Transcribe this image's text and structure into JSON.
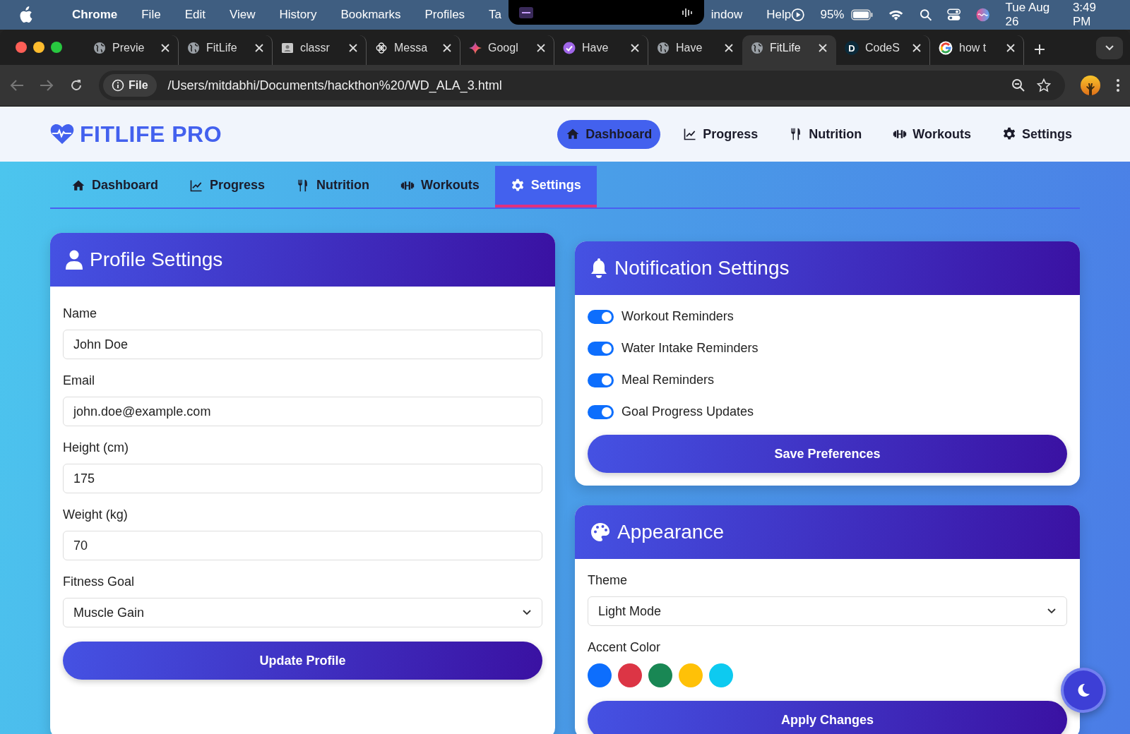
{
  "menu_bar": {
    "app": "Chrome",
    "items": [
      "File",
      "Edit",
      "View",
      "History",
      "Bookmarks",
      "Profiles",
      "Ta"
    ],
    "items_after_notch": [
      "indow",
      "Help"
    ],
    "battery": "95%",
    "date": "Tue Aug 26",
    "time": "3:49 PM"
  },
  "browser_tabs": [
    {
      "title": "Previe",
      "selected": false
    },
    {
      "title": "FitLife",
      "selected": false
    },
    {
      "title": "classr",
      "selected": false
    },
    {
      "title": "Messa",
      "selected": false
    },
    {
      "title": "Googl",
      "selected": false
    },
    {
      "title": "Have",
      "selected": false
    },
    {
      "title": "Have",
      "selected": false
    },
    {
      "title": "FitLife",
      "selected": true
    },
    {
      "title": "CodeS",
      "selected": false,
      "favicon_letter": "D"
    },
    {
      "title": "how t",
      "selected": false
    }
  ],
  "address_bar": {
    "scheme_chip": "File",
    "url": "/Users/mitdabhi/Documents/hackthon%20/WD_ALA_3.html"
  },
  "brand": "FITLIFE PRO",
  "top_nav": [
    {
      "label": "Dashboard",
      "selected": true
    },
    {
      "label": "Progress",
      "selected": false
    },
    {
      "label": "Nutrition",
      "selected": false
    },
    {
      "label": "Workouts",
      "selected": false
    },
    {
      "label": "Settings",
      "selected": false
    }
  ],
  "section_tabs": [
    {
      "label": "Dashboard",
      "selected": false
    },
    {
      "label": "Progress",
      "selected": false
    },
    {
      "label": "Nutrition",
      "selected": false
    },
    {
      "label": "Workouts",
      "selected": false
    },
    {
      "label": "Settings",
      "selected": true
    }
  ],
  "profile_settings": {
    "title": "Profile Settings",
    "fields": [
      {
        "label": "Name",
        "value": "John Doe",
        "kind": "text"
      },
      {
        "label": "Email",
        "value": "john.doe@example.com",
        "kind": "text"
      },
      {
        "label": "Height (cm)",
        "value": "175",
        "kind": "text"
      },
      {
        "label": "Weight (kg)",
        "value": "70",
        "kind": "text"
      },
      {
        "label": "Fitness Goal",
        "value": "Muscle Gain",
        "kind": "select"
      }
    ],
    "button": "Update Profile"
  },
  "notification_settings": {
    "title": "Notification Settings",
    "toggles": [
      {
        "label": "Workout Reminders",
        "on": true
      },
      {
        "label": "Water Intake Reminders",
        "on": true
      },
      {
        "label": "Meal Reminders",
        "on": true
      },
      {
        "label": "Goal Progress Updates",
        "on": true
      }
    ],
    "button": "Save Preferences"
  },
  "appearance": {
    "title": "Appearance",
    "theme_label": "Theme",
    "theme_value": "Light Mode",
    "accent_label": "Accent Color",
    "accent_colors": [
      {
        "color": "#0d6efd",
        "selected": false
      },
      {
        "color": "#dc3545",
        "selected": false
      },
      {
        "color": "#198754",
        "selected": false
      },
      {
        "color": "#ffc107",
        "selected": false
      },
      {
        "color": "#0dcaf0",
        "selected": false
      }
    ],
    "button": "Apply Changes"
  }
}
